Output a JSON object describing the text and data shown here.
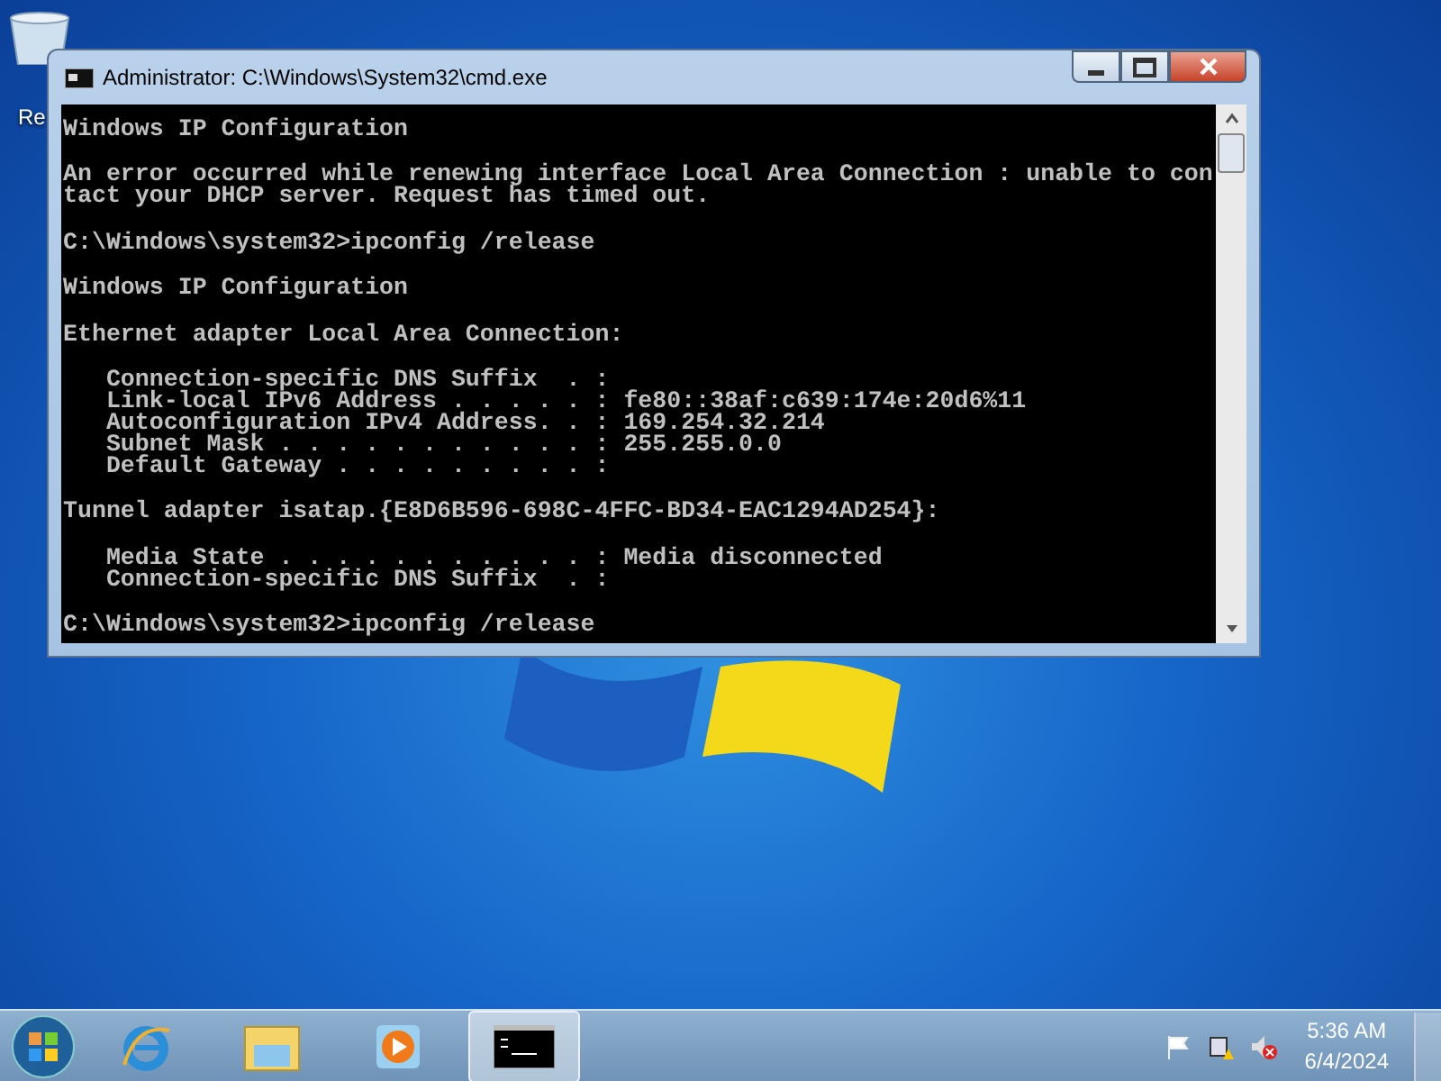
{
  "desktop": {
    "icons": [
      {
        "label": "Re"
      }
    ]
  },
  "window": {
    "title": "Administrator: C:\\Windows\\System32\\cmd.exe",
    "active": true,
    "console": {
      "blocks": [
        {
          "lines": [
            "Windows IP Configuration"
          ]
        },
        {
          "lines": [
            "An error occurred while renewing interface Local Area Connection : unable to con",
            "tact your DHCP server. Request has timed out."
          ]
        },
        {
          "lines": [
            "C:\\Windows\\system32>ipconfig /release"
          ]
        },
        {
          "lines": [
            "Windows IP Configuration"
          ]
        },
        {
          "lines": [
            "Ethernet adapter Local Area Connection:"
          ]
        },
        {
          "lines": [
            "   Connection-specific DNS Suffix  . :",
            "   Link-local IPv6 Address . . . . . : fe80::38af:c639:174e:20d6%11",
            "   Autoconfiguration IPv4 Address. . : 169.254.32.214",
            "   Subnet Mask . . . . . . . . . . . : 255.255.0.0",
            "   Default Gateway . . . . . . . . . :"
          ]
        },
        {
          "lines": [
            "Tunnel adapter isatap.{E8D6B596-698C-4FFC-BD34-EAC1294AD254}:"
          ]
        },
        {
          "lines": [
            "   Media State . . . . . . . . . . . : Media disconnected",
            "   Connection-specific DNS Suffix  . :"
          ]
        },
        {
          "lines": [
            "C:\\Windows\\system32>ipconfig /release"
          ]
        }
      ]
    }
  },
  "taskbar": {
    "apps": [
      {
        "kind": "ie",
        "active": false
      },
      {
        "kind": "explorer",
        "active": false
      },
      {
        "kind": "media",
        "active": false
      },
      {
        "kind": "cmd",
        "active": true
      }
    ],
    "clock": {
      "time": "5:36 AM",
      "date": "6/4/2024"
    }
  }
}
